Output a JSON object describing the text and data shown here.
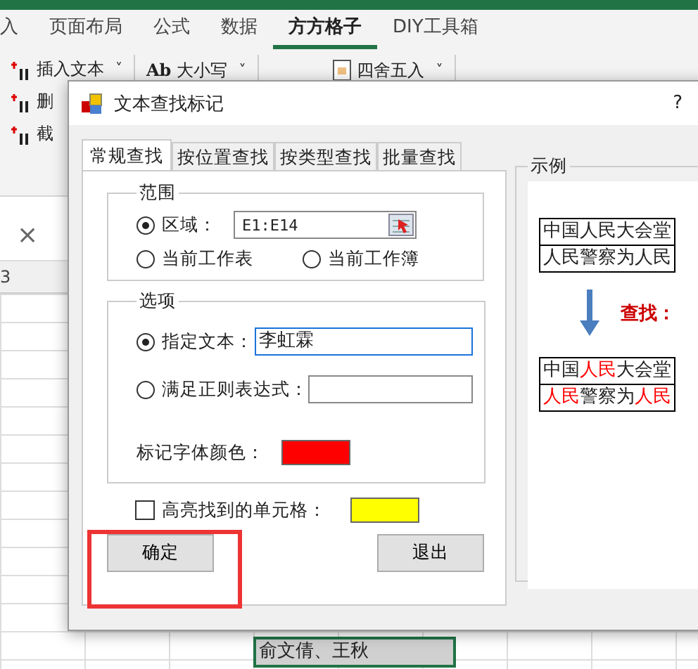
{
  "ribbon": {
    "tabs": [
      {
        "label": "入",
        "selected": false
      },
      {
        "label": "页面布局",
        "selected": false
      },
      {
        "label": "公式",
        "selected": false
      },
      {
        "label": "数据",
        "selected": false
      },
      {
        "label": "方方格子",
        "selected": true
      },
      {
        "label": "DIY工具箱",
        "selected": false
      }
    ],
    "commands": [
      {
        "label": "插入文本",
        "caret": "˅"
      },
      {
        "label": "删"
      },
      {
        "label": "截"
      }
    ],
    "commands_2": [
      {
        "prefix": "Ab",
        "label": "大小写",
        "caret": "˅"
      }
    ],
    "commands_3": [
      {
        "label": "四舍五入",
        "caret": "˅"
      }
    ]
  },
  "formula_bar": {
    "cancel": "×"
  },
  "sheet": {
    "column_header": "3",
    "cell": "俞文倩、王秋"
  },
  "dialog": {
    "title": "文本查找标记",
    "help": "?",
    "tabs": [
      {
        "label": "常规查找",
        "selected": true
      },
      {
        "label": "按位置查找",
        "selected": false
      },
      {
        "label": "按类型查找",
        "selected": false
      },
      {
        "label": "批量查找",
        "selected": false
      }
    ],
    "scope": {
      "title": "范围",
      "options": [
        {
          "label": "区域：",
          "selected": true
        },
        {
          "label": "当前工作表",
          "selected": false
        },
        {
          "label": "当前工作簿",
          "selected": false
        }
      ],
      "range": "E1:E14"
    },
    "options": {
      "title": "选项",
      "choices": [
        {
          "label": "指定文本：",
          "selected": true,
          "value": "李虹霖"
        },
        {
          "label": "满足正则表达式：",
          "selected": false
        }
      ],
      "color_label": "标记字体颜色：",
      "color": "#ff0000"
    },
    "highlight": {
      "label": "高亮找到的单元格：",
      "checked": false,
      "color": "#ffff00"
    },
    "buttons": [
      "确定",
      "退出"
    ],
    "example": {
      "title": "示例",
      "before": [
        [
          {
            "text": "中国人民大会堂",
            "found": false
          }
        ],
        [
          {
            "text": "人民警察为人民",
            "found": false
          }
        ]
      ],
      "search_label": "查找：",
      "after": [
        [
          {
            "text": "中国",
            "found": false
          },
          {
            "text": "人民",
            "found": true
          },
          {
            "text": "大会堂",
            "found": false
          }
        ],
        [
          {
            "text": "人民",
            "found": true
          },
          {
            "text": "警察为",
            "found": false
          },
          {
            "text": "人民",
            "found": true
          }
        ]
      ]
    }
  }
}
